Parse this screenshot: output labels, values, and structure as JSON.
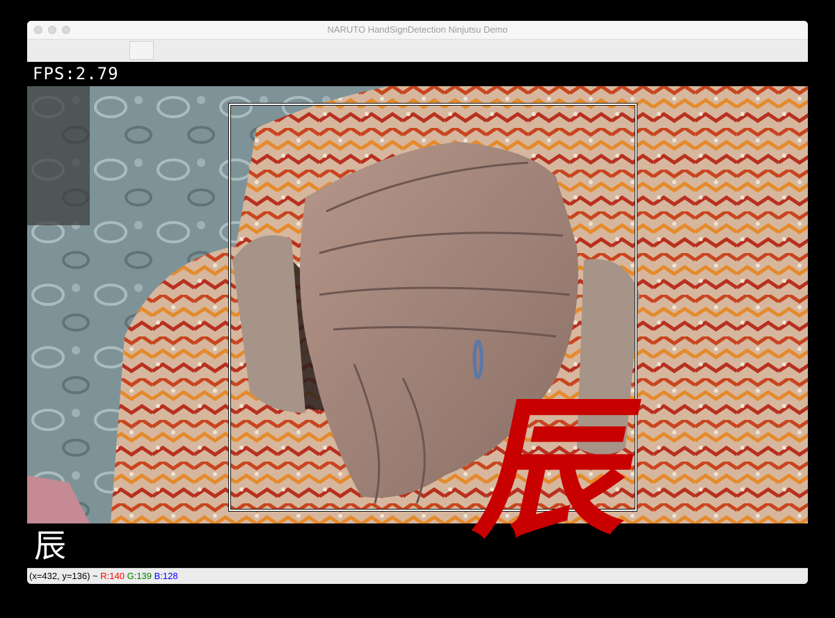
{
  "window": {
    "title": "NARUTO HandSignDetection Ninjutsu Demo"
  },
  "overlay": {
    "fps_text": "FPS:2.79",
    "detected_sign": "辰",
    "detected_sign_color": "#c80000",
    "bottom_sign": "辰"
  },
  "statusbar": {
    "coords": "(x=432, y=136) ~ ",
    "r_text": "R:140",
    "g_text": "G:139",
    "b_text": "B:128",
    "r_color": "#ff0000",
    "g_color": "#008000",
    "b_color": "#0000ff"
  }
}
